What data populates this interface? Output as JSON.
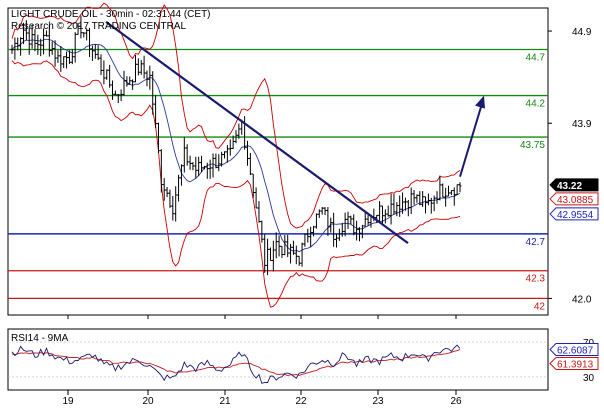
{
  "header": {
    "title": "LIGHT CRUDE OIL - 30min - 02:31:44 (CET)",
    "copyright": "Research © 2017 TRADING CENTRAL"
  },
  "rsi_panel": {
    "label": "RSI14 - 9MA"
  },
  "colors": {
    "candles": "#000000",
    "bollinger": "#cc0000",
    "ma": "#2a3aa0",
    "trendline": "#1a1a6e",
    "green_level": "#138a13",
    "blue_level": "#1a24b8",
    "red_level": "#c41a1a",
    "price_badge": "#000000",
    "ma_badge": "#1a24b8",
    "red_badge": "#c41a1a",
    "rsi_line": "#1a1a6e",
    "rsi_ma": "#c41a1a"
  },
  "chart_data": [
    {
      "type": "candlestick",
      "x_ticks": [
        "19",
        "20",
        "21",
        "22",
        "23",
        "26"
      ],
      "y_ticks": [
        "44.9",
        "43.9",
        "42.0"
      ],
      "ylim": [
        41.82,
        45.15
      ],
      "levels": [
        {
          "label": "44.7",
          "value": 44.7,
          "color": "green"
        },
        {
          "label": "44.2",
          "value": 44.2,
          "color": "green"
        },
        {
          "label": "43.75",
          "value": 43.75,
          "color": "green"
        },
        {
          "label": "42.7",
          "value": 42.7,
          "color": "blue"
        },
        {
          "label": "42.3",
          "value": 42.3,
          "color": "red"
        },
        {
          "label": "42",
          "value": 42.0,
          "color": "red"
        }
      ],
      "price_badges": [
        {
          "label": "43.22",
          "value": 43.22,
          "role": "last price"
        },
        {
          "label": "43.0885",
          "value": 43.0885,
          "role": "upper band"
        },
        {
          "label": "42.9554",
          "value": 42.9554,
          "role": "moving average"
        }
      ],
      "trendline": {
        "from": [
          "19",
          45.0
        ],
        "to": [
          "23",
          42.6
        ]
      },
      "arrow": {
        "from": [
          "26",
          43.32
        ],
        "to": [
          "26",
          44.2
        ]
      },
      "close_path": [
        44.7,
        44.92,
        44.75,
        44.82,
        44.6,
        44.62,
        44.95,
        44.7,
        44.45,
        44.2,
        44.35,
        44.5,
        44.4,
        43.3,
        43.0,
        43.55,
        43.4,
        43.45,
        43.5,
        43.55,
        43.9,
        43.2,
        42.4,
        42.6,
        42.5,
        42.45,
        42.8,
        42.95,
        42.7,
        42.85,
        42.75,
        42.9,
        42.95,
        43.0,
        43.05,
        43.1,
        43.0,
        43.15,
        43.2,
        43.22
      ]
    },
    {
      "type": "line",
      "title": "RSI14 - 9MA",
      "y_ticks": [
        "70",
        "30"
      ],
      "ylim": [
        15,
        85
      ],
      "badges": [
        {
          "label": "62.6087",
          "value": 62.6087,
          "role": "RSI"
        },
        {
          "label": "61.3913",
          "value": 61.3913,
          "role": "MA"
        }
      ],
      "series": [
        {
          "values": [
            58,
            62,
            55,
            60,
            52,
            48,
            50,
            56,
            44,
            40,
            46,
            50,
            42,
            30,
            28,
            44,
            40,
            46,
            38,
            44,
            58,
            36,
            24,
            30,
            34,
            32,
            44,
            50,
            46,
            56,
            44,
            50,
            48,
            54,
            52,
            58,
            50,
            60,
            62,
            62.6
          ]
        },
        {
          "values": [
            56,
            58,
            57,
            57,
            55,
            52,
            51,
            52,
            49,
            46,
            46,
            47,
            45,
            40,
            35,
            36,
            38,
            41,
            41,
            42,
            46,
            44,
            38,
            34,
            32,
            32,
            35,
            40,
            43,
            47,
            47,
            48,
            48,
            50,
            51,
            53,
            53,
            55,
            58,
            61.4
          ]
        }
      ]
    }
  ]
}
